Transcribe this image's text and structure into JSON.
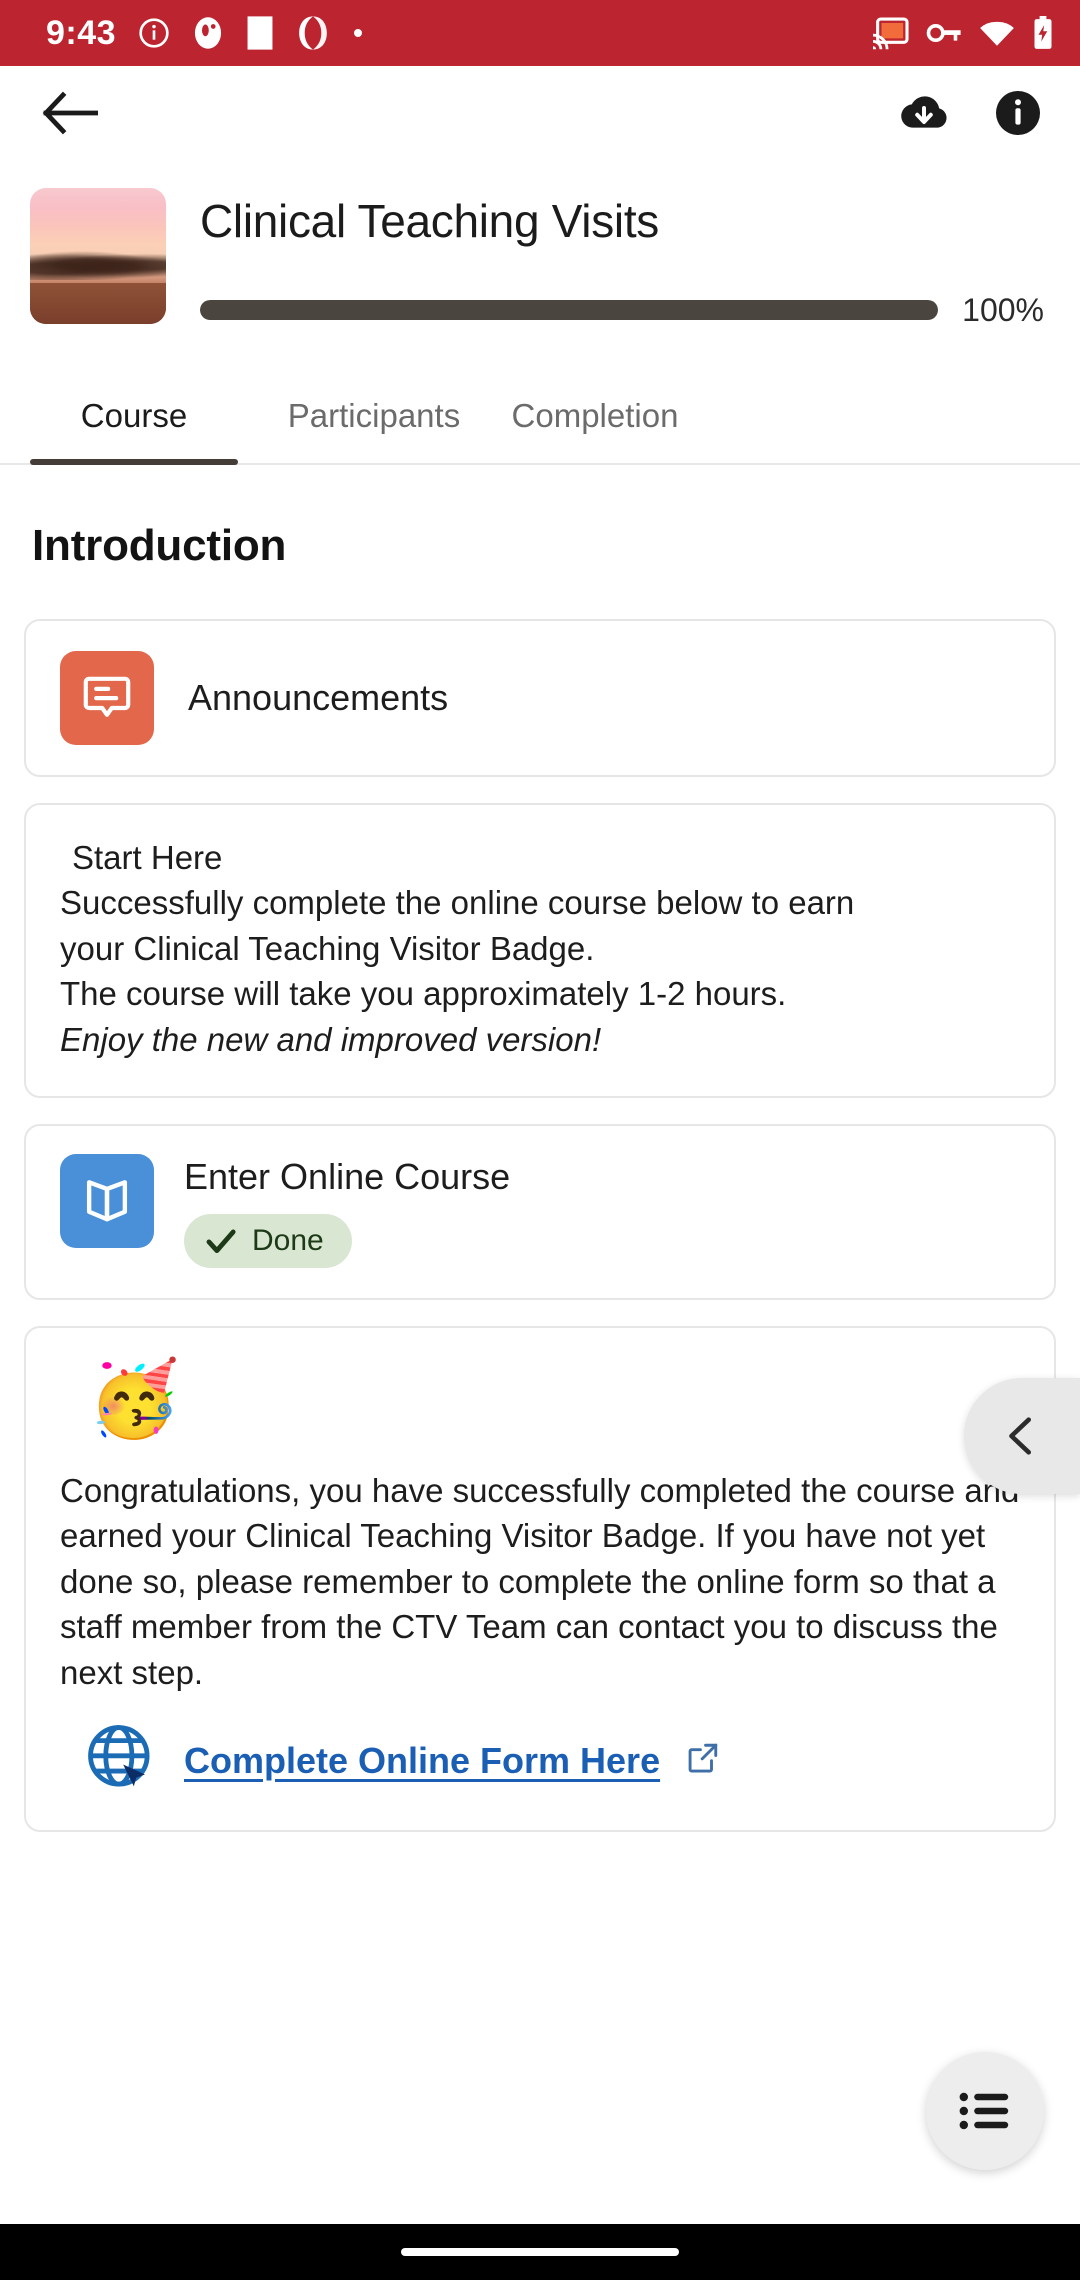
{
  "status_bar": {
    "time": "9:43",
    "background_color": "#BC2430",
    "left_icons": [
      "info-circle-icon",
      "app-badge-icon",
      "white-square-icon",
      "spiral-app-icon",
      "dot-icon"
    ],
    "right_icons": [
      "cast-icon",
      "vpn-key-icon",
      "wifi-icon",
      "battery-charging-icon"
    ]
  },
  "app_bar": {
    "back_label": "Back",
    "download_label": "Download course",
    "info_label": "Course summary"
  },
  "course": {
    "title": "Clinical Teaching Visits",
    "progress_percent_label": "100%",
    "progress_value": 100,
    "thumbnail_alt": "Sunset landscape with trees"
  },
  "tabs": [
    {
      "label": "Course",
      "active": true
    },
    {
      "label": "Participants",
      "active": false
    },
    {
      "label": "Completion",
      "active": false
    }
  ],
  "section": {
    "title": "Introduction"
  },
  "modules": {
    "announcements": {
      "label": "Announcements",
      "icon": "forum-icon",
      "icon_color": "#E2674B"
    },
    "start_here": {
      "heading": "Start Here",
      "line1": "Successfully complete the online course below to earn",
      "line2": "your Clinical Teaching Visitor Badge.",
      "line3": "The course will take you approximately 1-2 hours.",
      "line4": "Enjoy the new and improved version!"
    },
    "enter_course": {
      "label": "Enter Online Course",
      "icon": "book-icon",
      "icon_color": "#4A90D9",
      "status_label": "Done",
      "status_bg": "#D9E7D2",
      "status_color": "#1D3A18"
    },
    "congratulations": {
      "emoji": "🥳",
      "text": "Congratulations, you have successfully completed the course and earned your Clinical Teaching Visitor Badge. If you have not yet done so, please remember to complete the online form so that a staff member from the CTV Team can contact you to discuss the next step.",
      "link_label": "Complete Online Form Here",
      "link_color": "#1B5FB4",
      "link_icon": "external-link-icon",
      "globe_icon": "globe-click-icon"
    }
  },
  "floating": {
    "prev_label": "Previous",
    "menu_label": "Course index"
  }
}
